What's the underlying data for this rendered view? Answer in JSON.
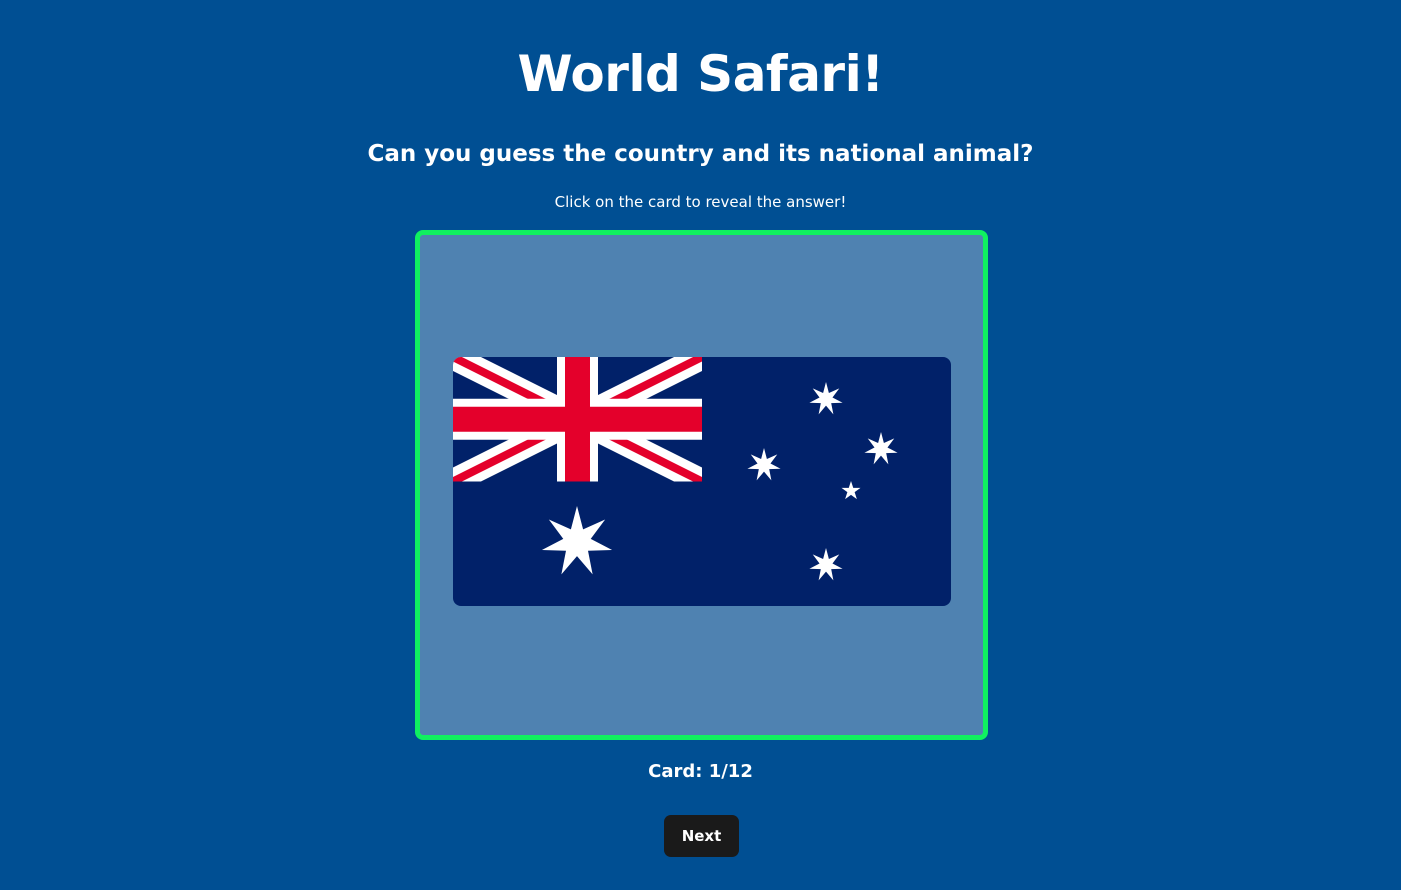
{
  "app": {
    "title": "World Safari!",
    "subtitle": "Can you guess the country and its national animal?",
    "instructions": "Click on the card to reveal the answer!"
  },
  "card": {
    "image": "australia-flag",
    "border_color": "#10F060",
    "background_color": "#4F82B1"
  },
  "progress": {
    "counter_text": "Card: 1/12",
    "current": 1,
    "total": 12
  },
  "controls": {
    "next_label": "Next"
  },
  "colors": {
    "page_background": "#004F93",
    "button_background": "#1A1A1A",
    "flag_blue": "#012169",
    "flag_red": "#E4002B",
    "flag_white": "#FFFFFF"
  }
}
